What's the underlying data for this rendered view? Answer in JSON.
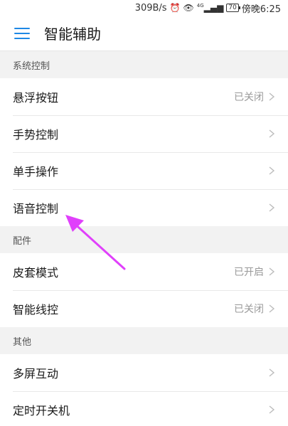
{
  "status_bar": {
    "network_speed": "309B/s",
    "alarm_icon": "alarm-icon",
    "eye_icon": "eye-icon",
    "signal_label": "4G",
    "battery": "70",
    "time": "傍晚6:25"
  },
  "appbar": {
    "title": "智能辅助",
    "menu_icon": "hamburger-menu-icon"
  },
  "sections": [
    {
      "header": "系统控制",
      "items": [
        {
          "label": "悬浮按钮",
          "status": "已关闭"
        },
        {
          "label": "手势控制",
          "status": ""
        },
        {
          "label": "单手操作",
          "status": ""
        },
        {
          "label": "语音控制",
          "status": ""
        }
      ]
    },
    {
      "header": "配件",
      "items": [
        {
          "label": "皮套模式",
          "status": "已开启"
        },
        {
          "label": "智能线控",
          "status": "已关闭"
        }
      ]
    },
    {
      "header": "其他",
      "items": [
        {
          "label": "多屏互动",
          "status": ""
        },
        {
          "label": "定时开关机",
          "status": ""
        }
      ]
    }
  ],
  "annotation": {
    "arrow_color": "#e040fb"
  },
  "colors": {
    "accent": "#1e88e5",
    "section_bg": "#f2f2f2",
    "muted_text": "#9a9a9a"
  }
}
